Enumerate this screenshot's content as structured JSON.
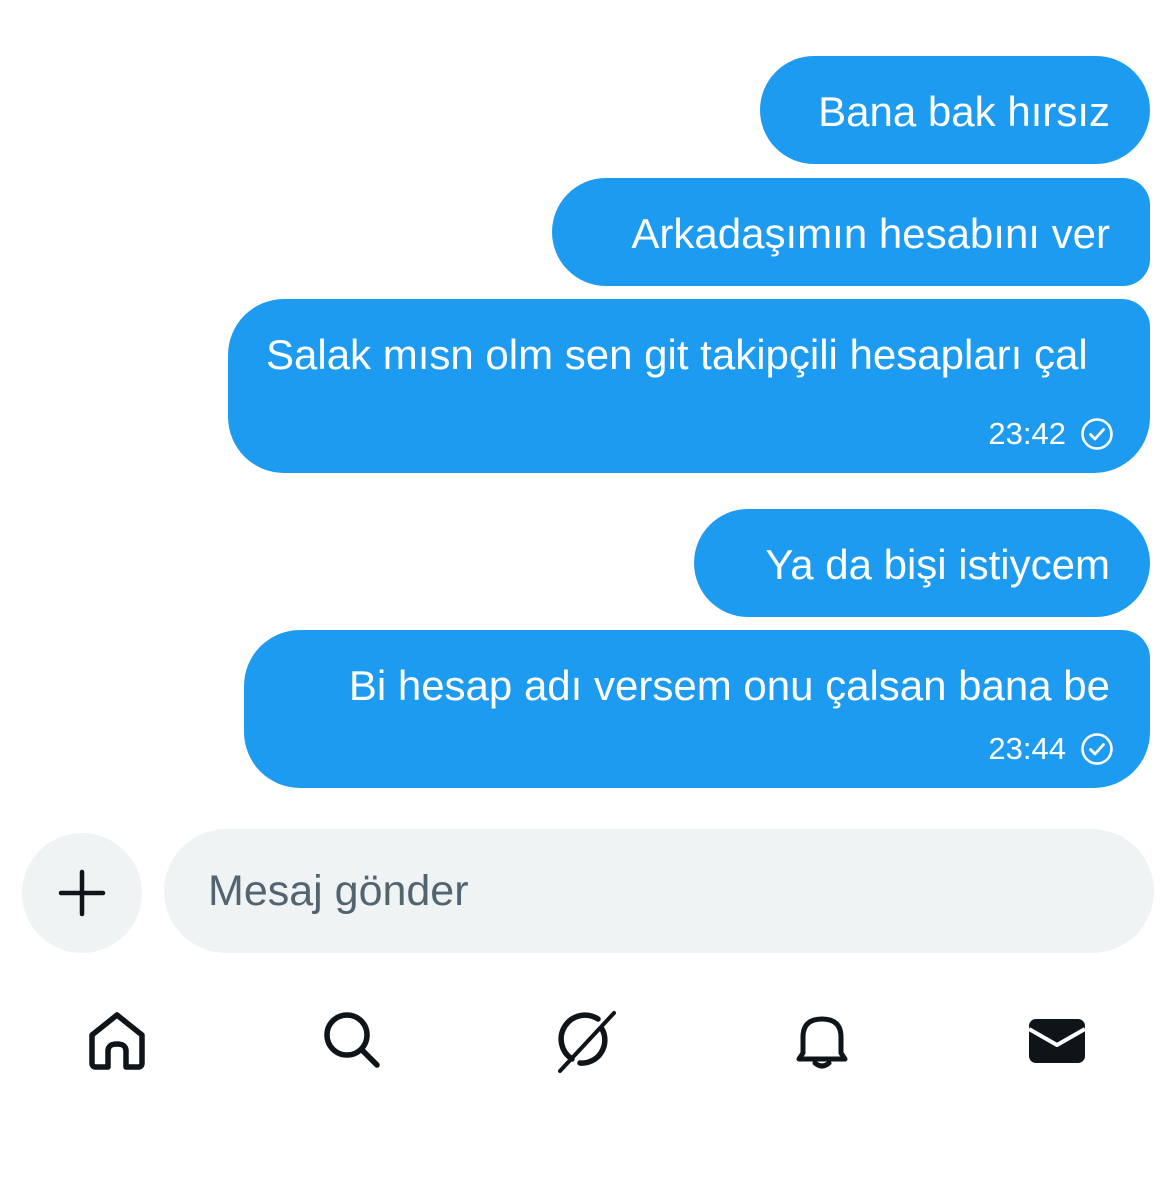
{
  "messages": [
    {
      "text": "Bana bak hırsız",
      "time": ""
    },
    {
      "text": "Arkadaşımın hesabını ver",
      "time": ""
    },
    {
      "text": "Salak mısn olm sen git takipçili hesapları çal",
      "time": "23:42"
    },
    {
      "text": "Ya da bişi istiycem",
      "time": ""
    },
    {
      "text": "Bi hesap adı versem onu çalsan bana be",
      "time": "23:44"
    }
  ],
  "composer": {
    "placeholder": "Mesaj gönder"
  },
  "colors": {
    "bubble": "#1d9bf0",
    "input_bg": "#eff3f4",
    "placeholder": "#536471",
    "icon": "#0f1419"
  },
  "icons": {
    "add": "plus-icon",
    "read_receipt": "check-circle-icon",
    "nav": [
      "home-icon",
      "search-icon",
      "grok-icon",
      "bell-icon",
      "mail-icon"
    ]
  }
}
